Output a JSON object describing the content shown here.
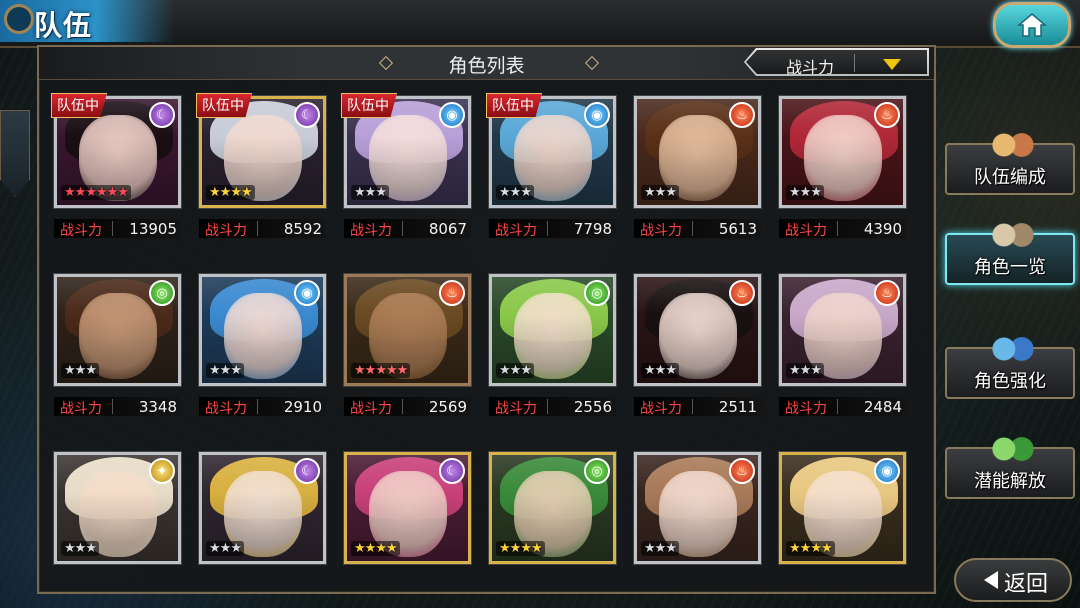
{
  "header": {
    "title": "队伍"
  },
  "panel": {
    "title": "角色列表",
    "sort": {
      "label": "战斗力"
    }
  },
  "power_label": "战斗力",
  "characters": [
    {
      "badge": "队伍中",
      "element": "dark",
      "stars": 6,
      "power": "13905"
    },
    {
      "badge": "队伍中",
      "element": "dark",
      "stars": 4,
      "power": "8592"
    },
    {
      "badge": "队伍中",
      "element": "water",
      "stars": 3,
      "power": "8067"
    },
    {
      "badge": "队伍中",
      "element": "water",
      "stars": 3,
      "power": "7798"
    },
    {
      "badge": "",
      "element": "fire",
      "stars": 3,
      "power": "5613"
    },
    {
      "badge": "",
      "element": "fire",
      "stars": 3,
      "power": "4390"
    },
    {
      "badge": "",
      "element": "wind",
      "stars": 3,
      "power": "3348"
    },
    {
      "badge": "",
      "element": "water",
      "stars": 3,
      "power": "2910"
    },
    {
      "badge": "",
      "element": "fire",
      "stars": 5,
      "power": "2569"
    },
    {
      "badge": "",
      "element": "wind",
      "stars": 3,
      "power": "2556"
    },
    {
      "badge": "",
      "element": "fire",
      "stars": 3,
      "power": "2511"
    },
    {
      "badge": "",
      "element": "fire",
      "stars": 3,
      "power": "2484"
    },
    {
      "badge": "",
      "element": "light",
      "stars": 3,
      "power": ""
    },
    {
      "badge": "",
      "element": "dark",
      "stars": 3,
      "power": ""
    },
    {
      "badge": "",
      "element": "dark",
      "stars": 4,
      "power": ""
    },
    {
      "badge": "",
      "element": "wind",
      "stars": 4,
      "power": ""
    },
    {
      "badge": "",
      "element": "fire",
      "stars": 3,
      "power": ""
    },
    {
      "badge": "",
      "element": "water",
      "stars": 4,
      "power": ""
    }
  ],
  "side_menu": [
    {
      "label": "队伍编成",
      "active": false
    },
    {
      "label": "角色一览",
      "active": true
    },
    {
      "label": "角色强化",
      "active": false
    },
    {
      "label": "潜能解放",
      "active": false
    }
  ],
  "back": {
    "label": "返回"
  },
  "colors": {
    "accent_cyan": "#4dd7e8",
    "badge_red": "#c8141c",
    "power_label_red": "#ff4545",
    "sort_arrow_yellow": "#f1c50e",
    "frame_gold": "#8a7a5c"
  }
}
